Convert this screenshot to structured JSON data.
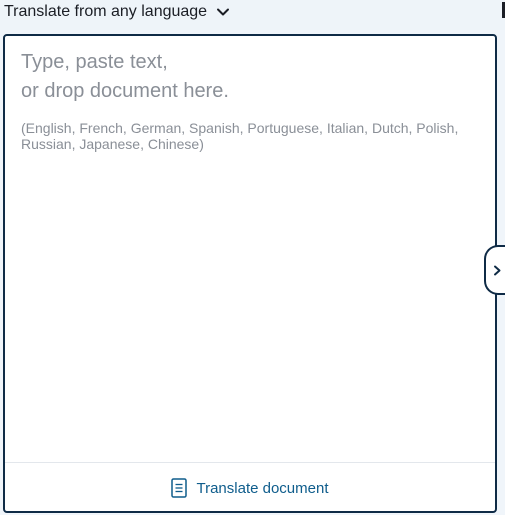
{
  "source": {
    "language_label": "Translate from any language",
    "dropdown_icon": "chevron-down-icon"
  },
  "editor": {
    "placeholder": "Type, paste text,\nor drop document here.",
    "supported_languages": "(English, French, German, Spanish, Portuguese, Italian, Dutch, Polish, Russian, Japanese, Chinese)"
  },
  "footer": {
    "translate_document_label": "Translate document",
    "icon": "document-icon"
  },
  "panel_toggle": {
    "icon": "chevron-right-icon"
  },
  "colors": {
    "border": "#0f2b46",
    "link": "#0f5d8c",
    "placeholder": "#8a8f97"
  }
}
